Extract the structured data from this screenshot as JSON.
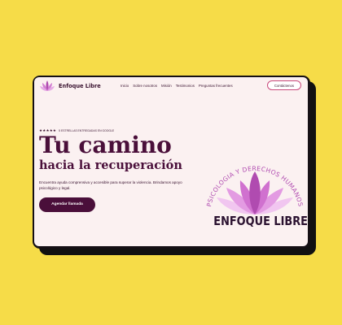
{
  "brand": {
    "name": "Enfoque Libre",
    "logo_text": "ENFOQUE LIBRE"
  },
  "nav": {
    "links": [
      "Inicio",
      "Sobre nosotros",
      "Misión",
      "Testimonios",
      "Preguntas frecuentes"
    ],
    "contact_label": "Contáctenos"
  },
  "hero": {
    "rating_stars": "★★★★★",
    "rating_text": "5 ESTRELLAS ENTREGADAS EN GOOGLE",
    "title": "Tu camino",
    "subtitle": "hacia la recuperación",
    "description": "Encuentra ayuda comprensiva y accesible para superar la violencia. Brindamos apoyo psicológico y legal.",
    "cta_label": "Agendar llamada"
  },
  "logo": {
    "arc_text": "PSICOLOGIA Y DERECHOS HUMANOS",
    "title": "ENFOQUE LIBRE"
  },
  "colors": {
    "background": "#f6dc48",
    "primary": "#4a0f3a",
    "accent": "#c94a7c",
    "lotus": "#c95fc8"
  }
}
